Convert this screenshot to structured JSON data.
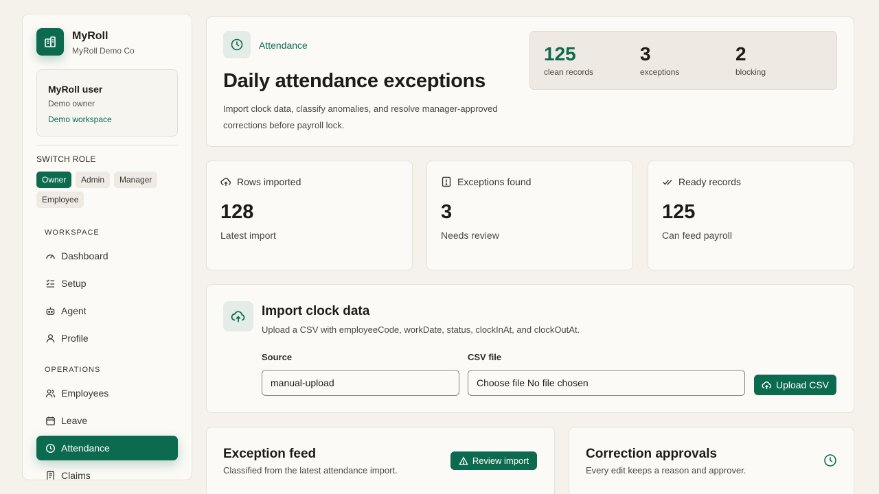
{
  "brand": {
    "name": "MyRoll",
    "org": "MyRoll Demo Co"
  },
  "user": {
    "name": "MyRoll user",
    "role": "Demo owner",
    "workspace": "Demo workspace"
  },
  "switch_role": {
    "label": "SWITCH ROLE",
    "roles": [
      "Owner",
      "Admin",
      "Manager",
      "Employee"
    ],
    "active": "Owner"
  },
  "nav": {
    "workspace_label": "WORKSPACE",
    "workspace_items": [
      "Dashboard",
      "Setup",
      "Agent",
      "Profile"
    ],
    "operations_label": "OPERATIONS",
    "operations_items": [
      "Employees",
      "Leave",
      "Attendance",
      "Claims"
    ],
    "active": "Attendance"
  },
  "header": {
    "eyebrow": "Attendance",
    "title": "Daily attendance exceptions",
    "description": "Import clock data, classify anomalies, and resolve manager-approved corrections before payroll lock.",
    "stats": [
      {
        "value": "125",
        "label": "clean records"
      },
      {
        "value": "3",
        "label": "exceptions"
      },
      {
        "value": "2",
        "label": "blocking"
      }
    ]
  },
  "metrics": [
    {
      "title": "Rows imported",
      "value": "128",
      "subtitle": "Latest import",
      "icon": "cloud-upload-icon"
    },
    {
      "title": "Exceptions found",
      "value": "3",
      "subtitle": "Needs review",
      "icon": "alert-file-icon"
    },
    {
      "title": "Ready records",
      "value": "125",
      "subtitle": "Can feed payroll",
      "icon": "double-check-icon"
    }
  ],
  "import": {
    "title": "Import clock data",
    "description": "Upload a CSV with employeeCode, workDate, status, clockInAt, and clockOutAt.",
    "source_label": "Source",
    "source_value": "manual-upload",
    "file_label": "CSV file",
    "file_value": "Choose file No file chosen",
    "upload_button": "Upload CSV"
  },
  "feed": {
    "title": "Exception feed",
    "description": "Classified from the latest attendance import.",
    "button": "Review import"
  },
  "approvals": {
    "title": "Correction approvals",
    "description": "Every edit keeps a reason and approver."
  },
  "colors": {
    "accent": "#0c6b4f",
    "background": "#f5f2ec",
    "card": "#fbfaf7"
  }
}
